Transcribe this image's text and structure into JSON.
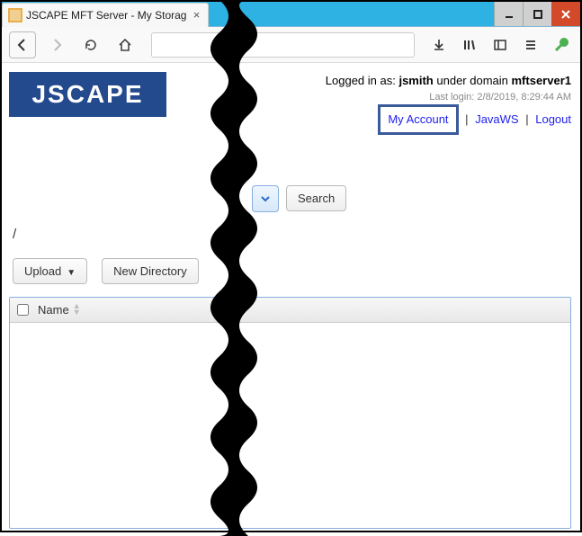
{
  "window": {
    "tab_title": "JSCAPE MFT Server - My Storag"
  },
  "logo_text": "JSCAPE",
  "login": {
    "prefix": "Logged in as: ",
    "user": "jsmith",
    "middle": " under domain ",
    "domain": "mftserver1",
    "last_login_label": "Last login: ",
    "last_login_value": "2/8/2019, 8:29:44 AM",
    "my_account": "My Account",
    "javaws": "JavaWS",
    "logout": "Logout"
  },
  "search": {
    "button_label": "Search"
  },
  "breadcrumb": "/",
  "actions": {
    "upload": "Upload",
    "new_directory": "New Directory"
  },
  "table": {
    "col_name": "Name"
  }
}
